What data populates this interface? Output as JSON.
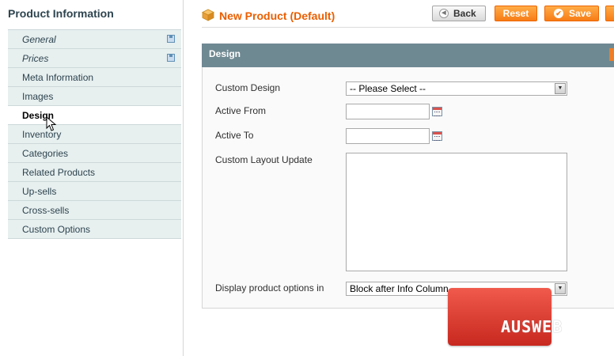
{
  "sidebar": {
    "title": "Product Information",
    "tabs": [
      {
        "label": "General"
      },
      {
        "label": "Prices"
      },
      {
        "label": "Meta Information"
      },
      {
        "label": "Images"
      },
      {
        "label": "Design"
      },
      {
        "label": "Inventory"
      },
      {
        "label": "Categories"
      },
      {
        "label": "Related Products"
      },
      {
        "label": "Up-sells"
      },
      {
        "label": "Cross-sells"
      },
      {
        "label": "Custom Options"
      }
    ]
  },
  "header": {
    "title": "New Product (Default)",
    "back_label": "Back",
    "reset_label": "Reset",
    "save_label": "Save"
  },
  "section": {
    "title": "Design",
    "fields": {
      "custom_design": {
        "label": "Custom Design",
        "value": "-- Please Select --"
      },
      "active_from": {
        "label": "Active From",
        "value": ""
      },
      "active_to": {
        "label": "Active To",
        "value": ""
      },
      "custom_layout_update": {
        "label": "Custom Layout Update",
        "value": ""
      },
      "display_options": {
        "label": "Display product options in",
        "value": "Block after Info Column"
      }
    }
  },
  "watermark": {
    "text": "AUSWEB"
  },
  "colors": {
    "accent": "#eb5e00",
    "section_header": "#6f8992",
    "tab_bg": "#e7efef"
  }
}
